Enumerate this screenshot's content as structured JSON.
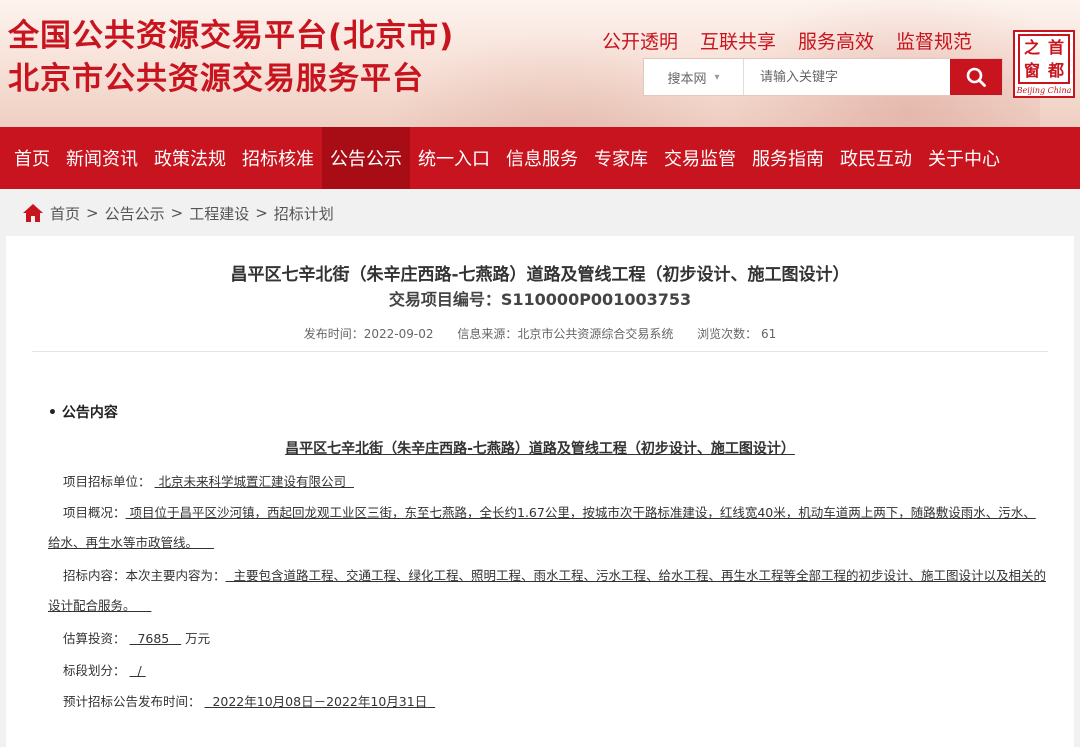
{
  "header": {
    "title_line1": "全国公共资源交易平台(北京市)",
    "title_line2": "北京市公共资源交易服务平台",
    "slogans": [
      "公开透明",
      "互联共享",
      "服务高效",
      "监督规范"
    ],
    "search": {
      "scope": "搜本网",
      "placeholder": "请输入关键字"
    },
    "logo": {
      "chars": [
        "之",
        "首",
        "窗",
        "都"
      ],
      "english": "Beijing China"
    }
  },
  "nav": {
    "items": [
      "首页",
      "新闻资讯",
      "政策法规",
      "招标核准",
      "公告公示",
      "统一入口",
      "信息服务",
      "专家库",
      "交易监管",
      "服务指南",
      "政民互动",
      "关于中心"
    ],
    "active": "公告公示"
  },
  "breadcrumb": [
    "首页",
    "公告公示",
    "工程建设",
    "招标计划"
  ],
  "notice": {
    "title": "昌平区七辛北街（朱辛庄西路-七燕路）道路及管线工程（初步设计、施工图设计）",
    "project_code": "交易项目编号：S110000P001003753",
    "publish_time": "发布时间：2022-09-02",
    "source": "信息来源：北京市公共资源综合交易系统",
    "views": "浏览次数： 61",
    "section_head": "• 公告内容",
    "doc_title": "昌平区七辛北街（朱辛庄西路-七燕路）道路及管线工程（初步设计、施工图设计）",
    "fields": {
      "unit_label": "项目招标单位：",
      "unit_value": "北京未来科学城置汇建设有限公司",
      "overview_label": "项目概况：",
      "overview_value": "项目位于昌平区沙河镇，西起回龙观工业区三街，东至七燕路，全长约1.67公里，按城市次干路标准建设，红线宽40米，机动车道两上两下，随路敷设雨水、污水、给水、再生水等市政管线。",
      "content_label": "招标内容：本次主要内容为：",
      "content_value": "主要包含道路工程、交通工程、绿化工程、照明工程、雨水工程、污水工程、给水工程、再生水工程等全部工程的初步设计、施工图设计以及相关的设计配合服务。",
      "investment_label": "估算投资：",
      "investment_value": "7685",
      "investment_unit": "万元",
      "section_label": "标段划分：",
      "section_value": "/",
      "publish_label": "预计招标公告发布时间：",
      "publish_value": "2022年10月08日－2022年10月31日"
    }
  },
  "colors": {
    "brand_red": "#c8141e",
    "nav_active": "#a80c14"
  }
}
